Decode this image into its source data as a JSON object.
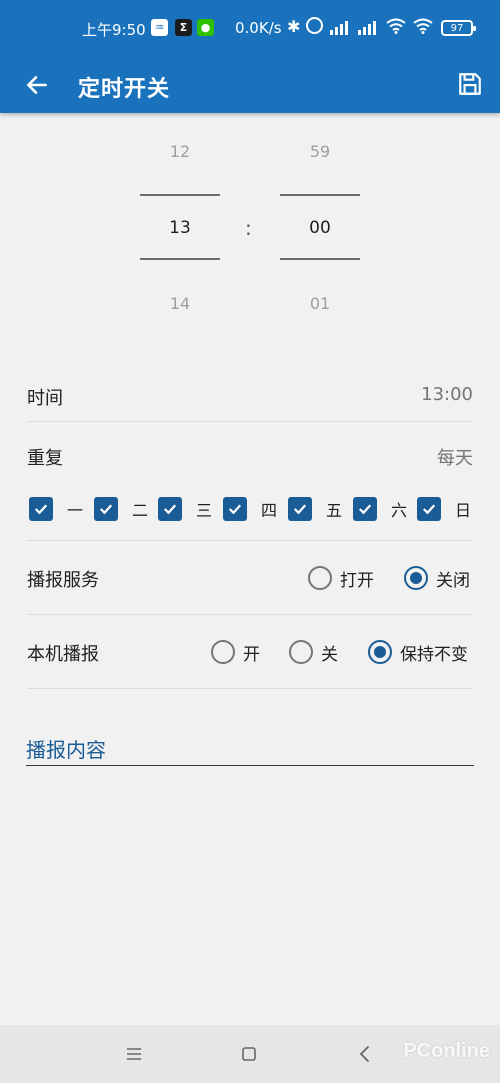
{
  "status_bar": {
    "time": "上午9:50",
    "speed": "0.0K/s",
    "battery": "97",
    "apps": [
      "voice-app-icon",
      "sigma-app-icon",
      "wechat-icon"
    ]
  },
  "toolbar": {
    "title": "定时开关",
    "back_icon": "arrow-left-icon",
    "save_icon": "save-icon"
  },
  "time_picker": {
    "hour": {
      "prev": "12",
      "current": "13",
      "next": "14"
    },
    "minute": {
      "prev": "59",
      "current": "00",
      "next": "01"
    },
    "separator": ":"
  },
  "time_row": {
    "label": "时间",
    "value": "13:00"
  },
  "repeat_row": {
    "label": "重复",
    "value": "每天"
  },
  "weekdays": [
    {
      "label": "一",
      "checked": true
    },
    {
      "label": "二",
      "checked": true
    },
    {
      "label": "三",
      "checked": true
    },
    {
      "label": "四",
      "checked": true
    },
    {
      "label": "五",
      "checked": true
    },
    {
      "label": "六",
      "checked": true
    },
    {
      "label": "日",
      "checked": true
    }
  ],
  "broadcast_service": {
    "label": "播报服务",
    "options": [
      {
        "label": "打开",
        "checked": false
      },
      {
        "label": "关闭",
        "checked": true
      }
    ]
  },
  "local_broadcast": {
    "label": "本机播报",
    "options": [
      {
        "label": "开",
        "checked": false
      },
      {
        "label": "关",
        "checked": false
      },
      {
        "label": "保持不变",
        "checked": true
      }
    ]
  },
  "content_field": {
    "label": "播报内容",
    "value": ""
  },
  "watermark": "PConline",
  "colors": {
    "primary": "#1a72bd",
    "accent": "#1a5c96",
    "background": "#f1f1f1"
  }
}
